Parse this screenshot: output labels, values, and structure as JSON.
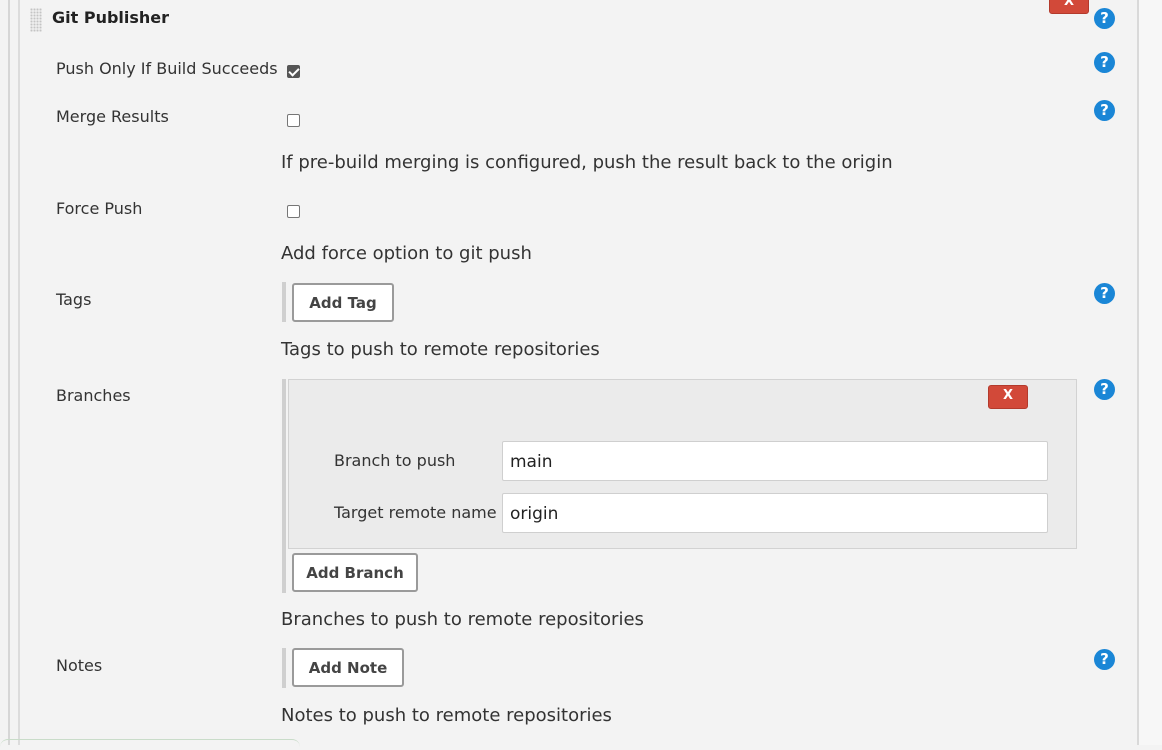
{
  "section": {
    "title": "Git Publisher",
    "remove_label": "X"
  },
  "help_glyph": "?",
  "push_only": {
    "label": "Push Only If Build Succeeds",
    "checked": true
  },
  "merge_results": {
    "label": "Merge Results",
    "checked": false,
    "description": "If pre-build merging is configured, push the result back to the origin"
  },
  "force_push": {
    "label": "Force Push",
    "checked": false,
    "description": "Add force option to git push"
  },
  "tags": {
    "label": "Tags",
    "button_label": "Add Tag",
    "description": "Tags to push to remote repositories"
  },
  "branches": {
    "label": "Branches",
    "remove_label": "X",
    "branch_to_push_label": "Branch to push",
    "branch_to_push_value": "main",
    "target_remote_label": "Target remote name",
    "target_remote_value": "origin",
    "button_label": "Add Branch",
    "description": "Branches to push to remote repositories"
  },
  "notes": {
    "label": "Notes",
    "button_label": "Add Note",
    "description": "Notes to push to remote repositories"
  },
  "colors": {
    "help": "#1a86d6",
    "remove": "#d24939",
    "background": "#f3f3f3"
  }
}
